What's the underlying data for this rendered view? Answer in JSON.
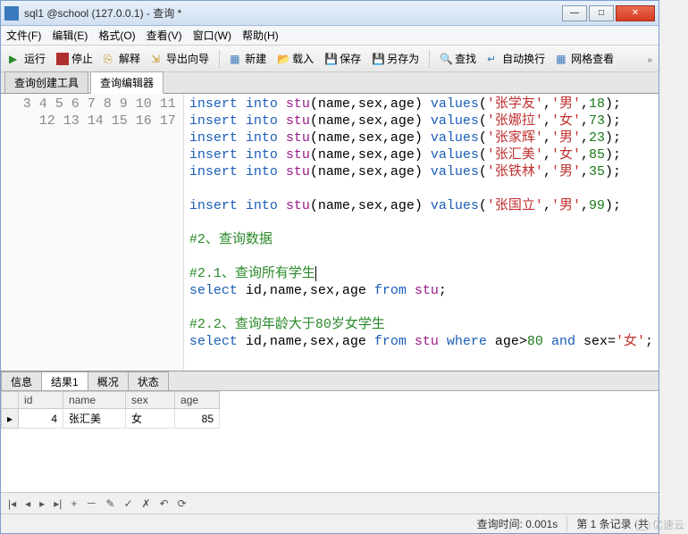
{
  "window": {
    "title": "sql1 @school (127.0.0.1) - 查询 *"
  },
  "menu": {
    "file": "文件(F)",
    "edit": "编辑(E)",
    "format": "格式(O)",
    "view": "查看(V)",
    "window": "窗口(W)",
    "help": "帮助(H)"
  },
  "toolbar": {
    "run": "运行",
    "stop": "停止",
    "explain": "解释",
    "export": "导出向导",
    "new": "新建",
    "load": "载入",
    "save": "保存",
    "saveas": "另存为",
    "find": "查找",
    "wrap": "自动换行",
    "gridview": "网格查看"
  },
  "tabs": {
    "builder": "查询创建工具",
    "editor": "查询编辑器"
  },
  "code": {
    "lines": [
      3,
      4,
      5,
      6,
      7,
      8,
      9,
      10,
      11,
      12,
      13,
      14,
      15,
      16,
      17
    ],
    "l3": {
      "a": "insert into ",
      "b": "stu",
      "c": "(name,sex,age) ",
      "d": "values",
      "e": "(",
      "s1": "'张学友'",
      "f": ",",
      "s2": "'男'",
      "g": ",",
      "n": "18",
      "h": ");"
    },
    "l4": {
      "a": "insert into ",
      "b": "stu",
      "c": "(name,sex,age) ",
      "d": "values",
      "e": "(",
      "s1": "'张娜拉'",
      "f": ",",
      "s2": "'女'",
      "g": ",",
      "n": "73",
      "h": ");"
    },
    "l5": {
      "a": "insert into ",
      "b": "stu",
      "c": "(name,sex,age) ",
      "d": "values",
      "e": "(",
      "s1": "'张家辉'",
      "f": ",",
      "s2": "'男'",
      "g": ",",
      "n": "23",
      "h": ");"
    },
    "l6": {
      "a": "insert into ",
      "b": "stu",
      "c": "(name,sex,age) ",
      "d": "values",
      "e": "(",
      "s1": "'张汇美'",
      "f": ",",
      "s2": "'女'",
      "g": ",",
      "n": "85",
      "h": ");"
    },
    "l7": {
      "a": "insert into ",
      "b": "stu",
      "c": "(name,sex,age) ",
      "d": "values",
      "e": "(",
      "s1": "'张铁林'",
      "f": ",",
      "s2": "'男'",
      "g": ",",
      "n": "35",
      "h": ");"
    },
    "l9": {
      "a": "insert into ",
      "b": "stu",
      "c": "(name,sex,age) ",
      "d": "values",
      "e": "(",
      "s1": "'张国立'",
      "f": ",",
      "s2": "'男'",
      "g": ",",
      "n": "99",
      "h": ");"
    },
    "l11": "#2、查询数据",
    "l13": "#2.1、查询所有学生",
    "l14": {
      "a": "select ",
      "b": "id,name,sex,age ",
      "c": "from ",
      "d": "stu",
      "e": ";"
    },
    "l16": "#2.2、查询年龄大于80岁女学生",
    "l17": {
      "a": "select ",
      "b": "id,name,sex,age ",
      "c": "from ",
      "d": "stu ",
      "e": "where ",
      "f": "age>",
      "n": "80",
      "g": " and ",
      "h": "sex=",
      "s": "'女'",
      "i": ";"
    }
  },
  "results": {
    "tabs": {
      "info": "信息",
      "r1": "结果1",
      "profile": "概况",
      "status": "状态"
    },
    "cols": {
      "id": "id",
      "name": "name",
      "sex": "sex",
      "age": "age"
    },
    "row": {
      "id": "4",
      "name": "张汇美",
      "sex": "女",
      "age": "85"
    },
    "nav": {
      "first": "|◂",
      "prev": "◂",
      "next": "▸",
      "last": "▸|",
      "add": "+",
      "del": "－",
      "edit": "✎",
      "ok": "✓",
      "cancel": "✗",
      "undo": "↶",
      "refresh": "⟳"
    }
  },
  "status": {
    "time": "查询时间: 0.001s",
    "count": "第 1 条记录 (共"
  },
  "watermark": "亿速云"
}
